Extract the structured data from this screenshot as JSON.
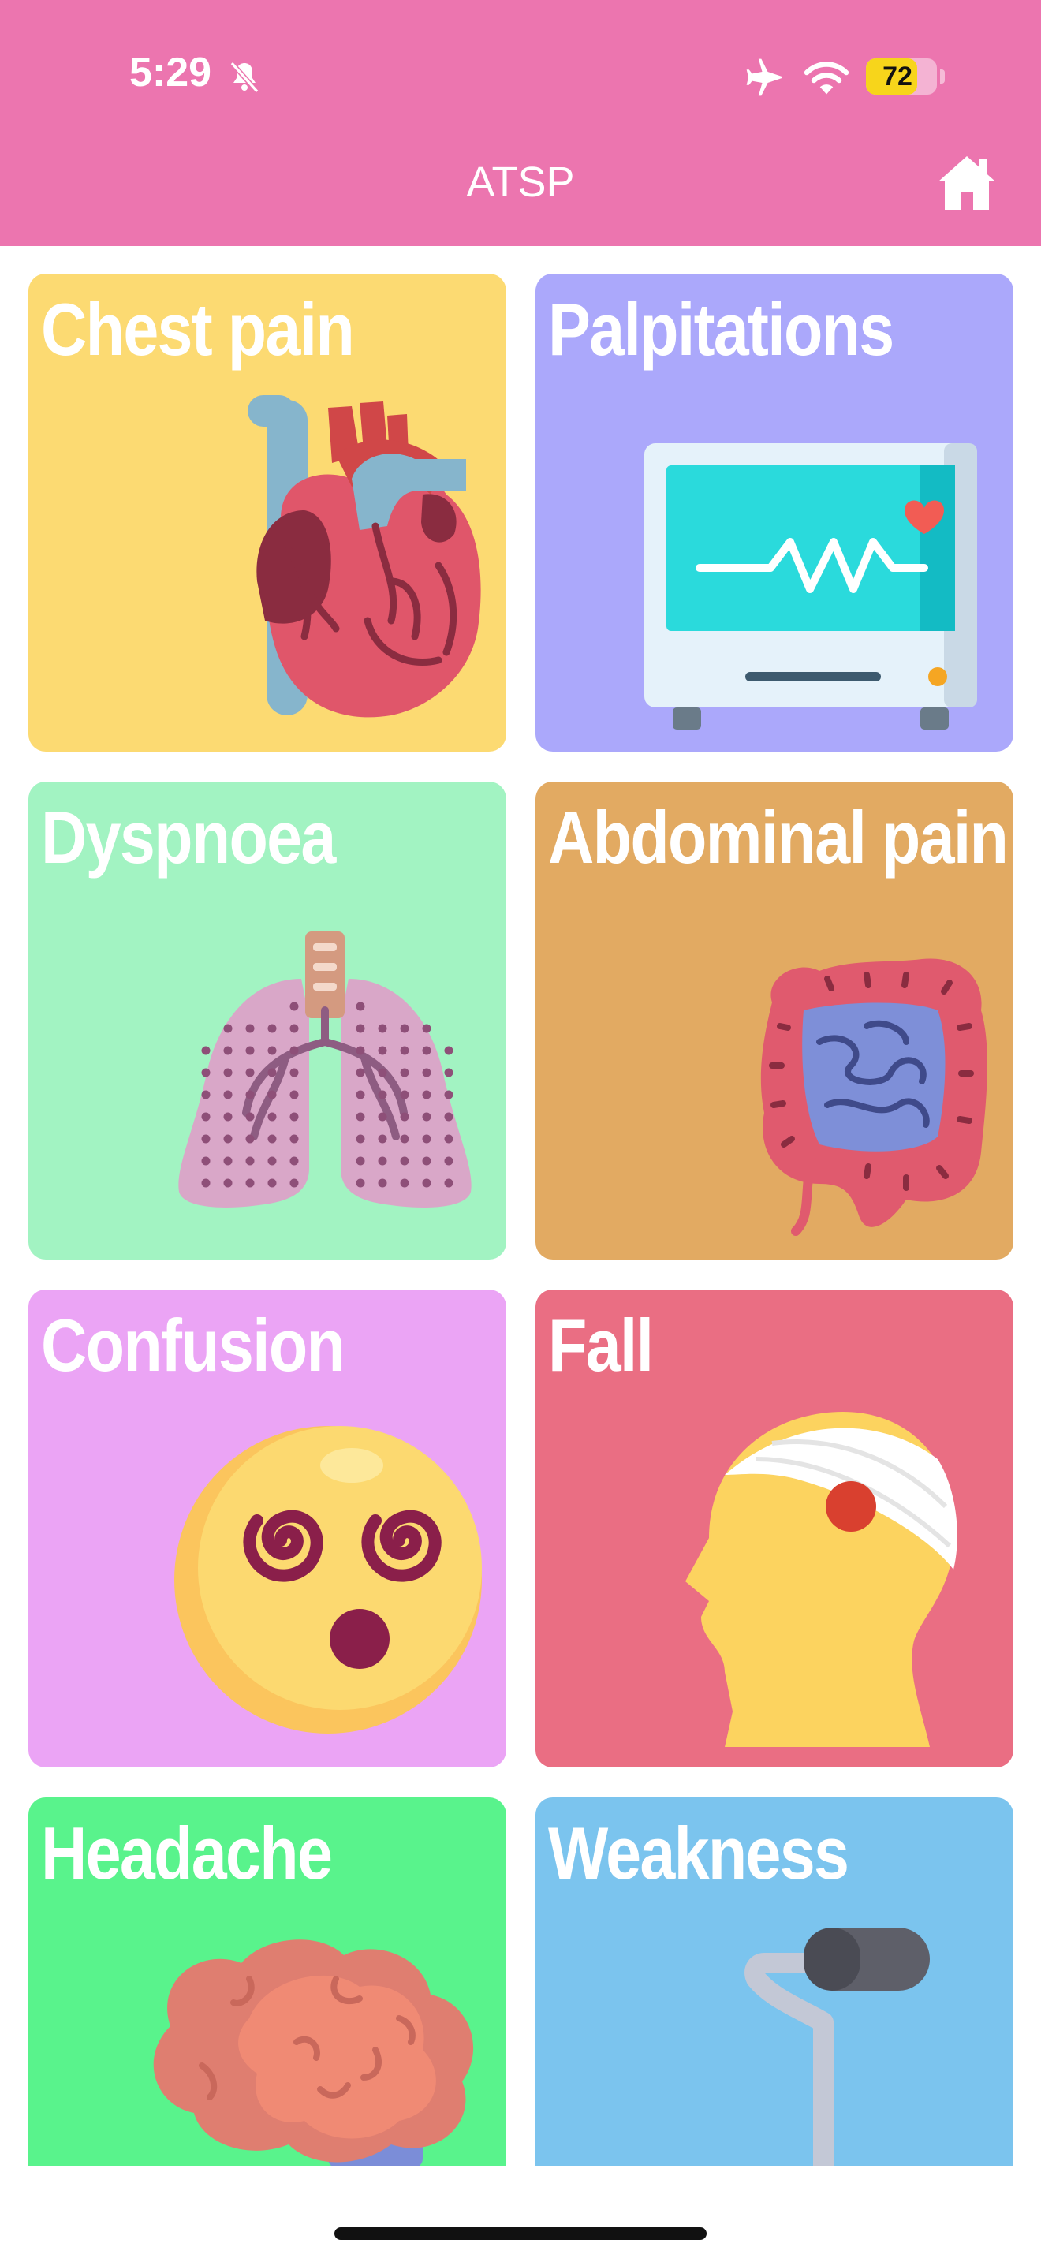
{
  "status_bar": {
    "time": "5:29",
    "battery": "72",
    "battery_level": 0.72
  },
  "nav": {
    "title": "ATSP"
  },
  "tiles": [
    {
      "label": "Chest pain",
      "color": "#FCDA72",
      "icon": "heart-icon"
    },
    {
      "label": "Palpitations",
      "color": "#ABA8FB",
      "icon": "ecg-monitor-icon"
    },
    {
      "label": "Dyspnoea",
      "color": "#A2F3C2",
      "icon": "lungs-icon"
    },
    {
      "label": "Abdominal pain",
      "color": "#E2AA62",
      "icon": "intestines-icon"
    },
    {
      "label": "Confusion",
      "color": "#EBA4F5",
      "icon": "dizzy-face-icon"
    },
    {
      "label": "Fall",
      "color": "#EA6E83",
      "icon": "bandaged-head-icon"
    },
    {
      "label": "Headache",
      "color": "#59F38C",
      "icon": "brain-icon"
    },
    {
      "label": "Weakness",
      "color": "#7BC4EE",
      "icon": "walking-aid-icon"
    }
  ]
}
